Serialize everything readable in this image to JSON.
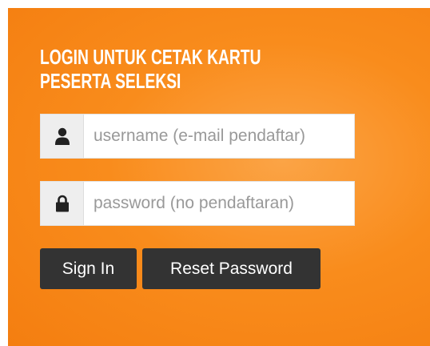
{
  "login": {
    "title": "LOGIN UNTUK CETAK KARTU PESERTA SELEKSI",
    "username": {
      "value": "",
      "placeholder": "username (e-mail pendaftar)",
      "icon": "user-icon"
    },
    "password": {
      "value": "",
      "placeholder": "password (no pendaftaran)",
      "icon": "lock-icon"
    },
    "signin_label": "Sign In",
    "reset_label": "Reset Password"
  },
  "colors": {
    "panel": "#f98c1c",
    "button": "#333333",
    "text_light": "#ffffff"
  }
}
